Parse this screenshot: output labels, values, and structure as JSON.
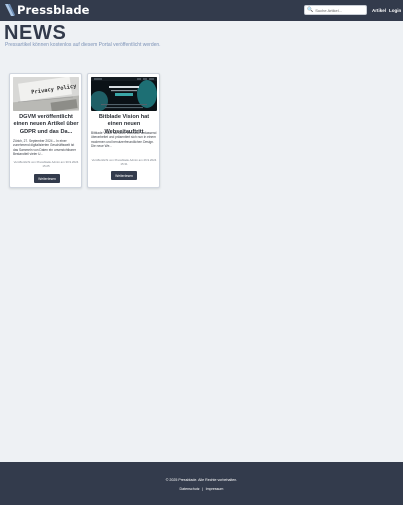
{
  "header": {
    "logo_text": "Pressblade",
    "search_placeholder": "Suche Artikel...",
    "nav": [
      "Artikel",
      "Login"
    ]
  },
  "page": {
    "title": "NEWS",
    "subtitle": "Pressartikel können kostenlos auf diesem Portal veröffentlicht werden."
  },
  "cards": [
    {
      "thumb_text": "Privacy Policy",
      "title": "DGVM veröffentlicht einen neuen Artikel über GDPR und das Da...",
      "excerpt": "Zürich, 27. September 2024 – In einer zunehmend digitalisierten Geschäftswelt ist das Sammeln von Daten ein unverzichtbarer Bestandteil vieler U...",
      "meta": "Veröffentlicht von Pressblade Admin am 30.9.2024 15:25",
      "button": "Weiterlesen"
    },
    {
      "thumb_text": "",
      "title": "Bitblade Vision hat einen neuen Webseitauftritt",
      "excerpt": "Bitblade Vision hat seine Webseite umfassend überarbeitet und präsentiert sich nun in einem modernen und benutzerfreundlichen Design. Die neue We...",
      "meta": "Veröffentlicht von Pressblade Admin am 26.9.2024 15:31",
      "button": "Weiterlesen"
    }
  ],
  "footer": {
    "copyright": "© 2025 Pressblade. Alle Rechte vorbehalten.",
    "links": [
      "Datenschutz",
      "|",
      "Impressum"
    ]
  },
  "colors": {
    "navbar": "#333b4c",
    "background": "#eef1f4",
    "subtitle": "#7d93b7",
    "button": "#333b4c"
  }
}
